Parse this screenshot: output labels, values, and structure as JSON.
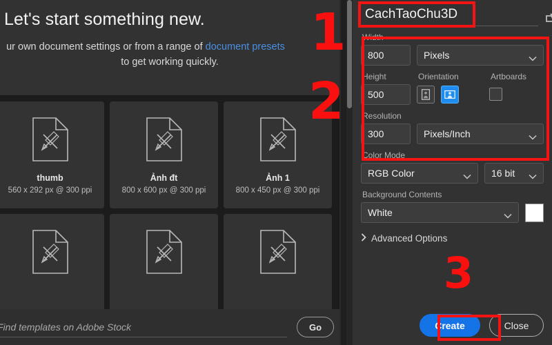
{
  "left_panel": {
    "hero_title": "Let's start something new.",
    "hero_sub_line1_pre": "ur own document settings or from a range of ",
    "hero_sub_link": "document presets",
    "hero_sub_line2": "to get working quickly.",
    "templates": [
      {
        "name": "thumb",
        "meta": "560 x 292 px @ 300 ppi",
        "icon": "document-pencil-ruler-icon"
      },
      {
        "name": "Ảnh đt",
        "meta": "800 x 600 px @ 300 ppi",
        "icon": "document-pencil-ruler-icon"
      },
      {
        "name": "Ảnh 1",
        "meta": "800 x 450 px @ 300 ppi",
        "icon": "document-pencil-ruler-icon"
      }
    ],
    "templates_row2": [
      {
        "icon": "document-pencil-ruler-icon"
      },
      {
        "icon": "document-pencil-ruler-icon"
      },
      {
        "icon": "document-pencil-ruler-icon"
      }
    ],
    "stock": {
      "placeholder": "Find templates on Adobe Stock",
      "value": "",
      "go_label": "Go"
    }
  },
  "right_panel": {
    "document_name": "CachTaoChu3D",
    "save_preset_icon": "save-preset-icon",
    "width": {
      "label": "Width",
      "value": "800",
      "unit": "Pixels"
    },
    "height": {
      "label": "Height",
      "value": "500"
    },
    "orientation": {
      "label": "Orientation",
      "portrait_icon": "portrait-orientation-icon",
      "landscape_icon": "landscape-orientation-icon",
      "selected": "landscape"
    },
    "artboards": {
      "label": "Artboards",
      "checked": false
    },
    "resolution": {
      "label": "Resolution",
      "value": "300",
      "unit": "Pixels/Inch"
    },
    "color_mode": {
      "label": "Color Mode",
      "value": "RGB Color",
      "depth": "16 bit"
    },
    "background_contents": {
      "label": "Background Contents",
      "value": "White",
      "swatch_color": "#FFFFFF"
    },
    "advanced_options": {
      "label": "Advanced Options",
      "expanded": false
    },
    "buttons": {
      "create": "Create",
      "close": "Close"
    }
  },
  "annotations": {
    "step1": "1",
    "step2": "2",
    "step3": "3",
    "color": "#F51414"
  }
}
